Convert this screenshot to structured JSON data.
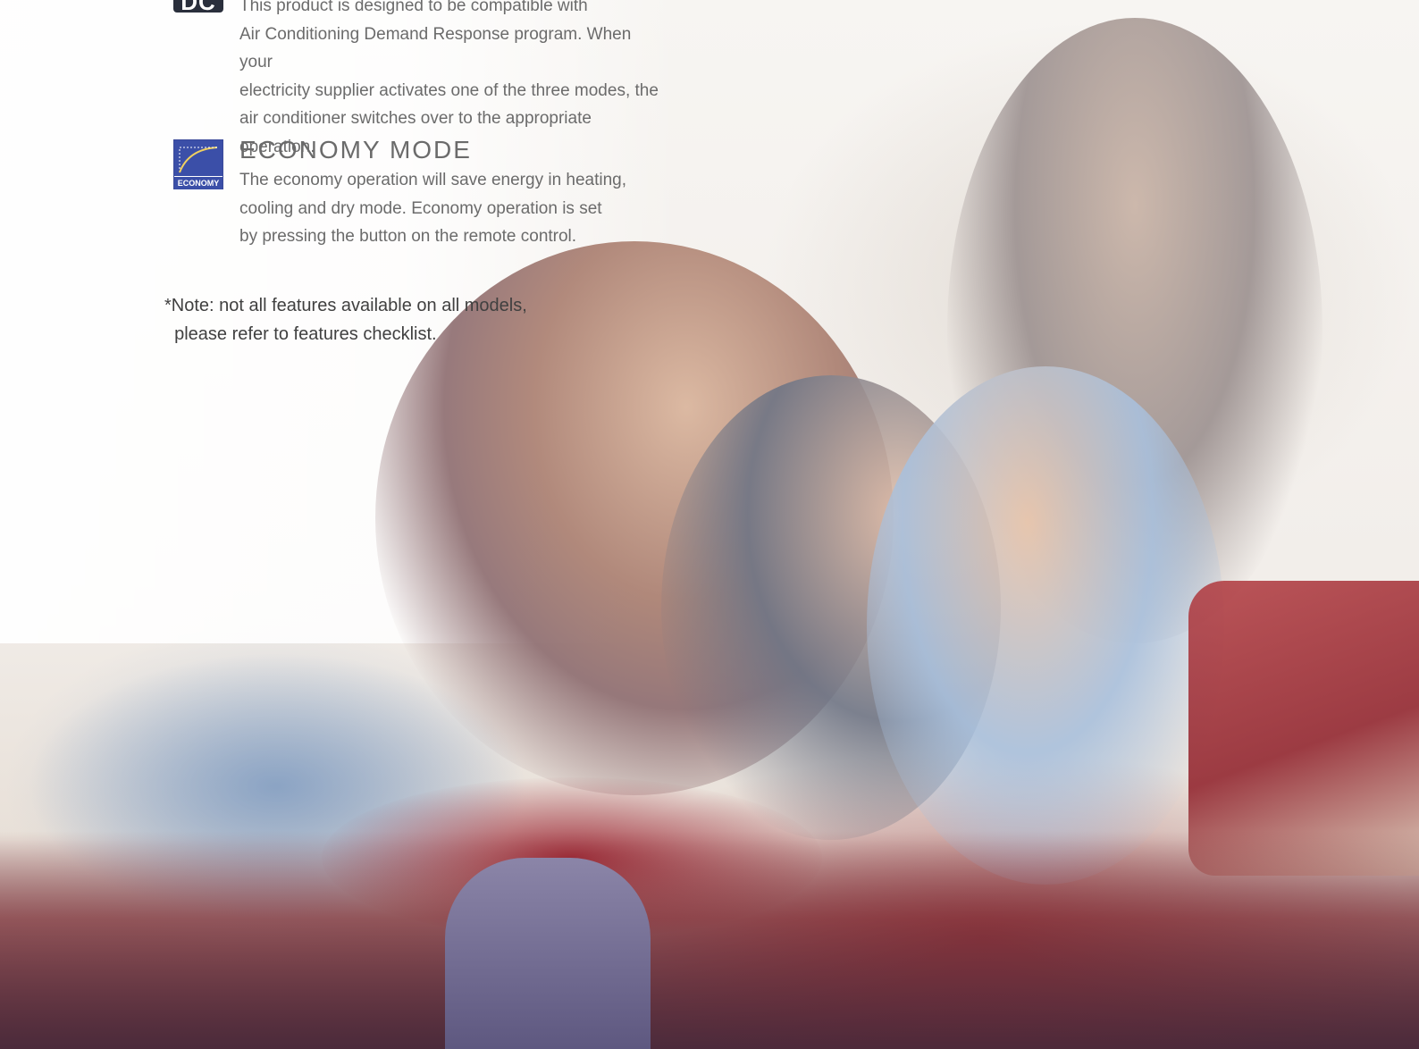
{
  "features": {
    "dc": {
      "badge_label": "DC",
      "text_lines": [
        "This product is designed to be compatible with",
        "Air Conditioning Demand Response program. When your",
        "electricity supplier activates one of the three modes, the",
        "air conditioner switches over to the appropriate operation."
      ]
    },
    "economy": {
      "badge_label": "ECONOMY",
      "title": "ECONOMY MODE",
      "text_lines": [
        "The economy operation will save energy in heating,",
        "cooling and dry mode. Economy operation is set",
        "by pressing the button on the remote control."
      ]
    }
  },
  "note": {
    "line1": "*Note: not all features available on all models,",
    "line2": "  please refer to features checklist."
  },
  "colors": {
    "text": "#6b6b6b",
    "note_text": "#404040",
    "economy_badge": "#3b4fa8",
    "dc_badge": "#2a2f3c"
  }
}
